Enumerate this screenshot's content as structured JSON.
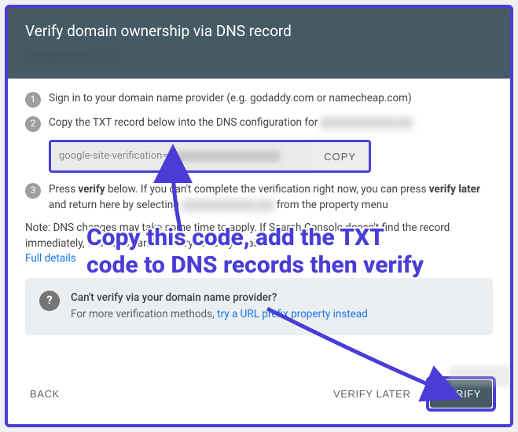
{
  "header": {
    "title": "Verify domain ownership via DNS record",
    "subtitle_placeholder": "xxxxx@xxxxxxx.xxx"
  },
  "steps": {
    "s1": "Sign in to your domain name provider (e.g. godaddy.com or namecheap.com)",
    "s2_prefix": "Copy the TXT record below into the DNS configuration for ",
    "s2_blur": "xxxxxxxxxxxxxx.xxx",
    "txt_prefix": "google-site-verification=",
    "copy_label": "COPY",
    "s3_a": "Press ",
    "s3_b": "verify",
    "s3_c": " below. If you can't complete the verification right now, you can press ",
    "s3_d": "verify later",
    "s3_e": " and return here by selecting ",
    "s3_blur": "xxxxxxxxxxxxxx.xxx",
    "s3_f": " from the property menu"
  },
  "note": {
    "a": "Note: DNS changes may take some time to apply. If Search Console doesn't find the record immediately, wait a day and then try to verify again",
    "link": "Full details"
  },
  "info": {
    "title": "Can't verify via your domain name provider?",
    "body_a": "For more verification methods, ",
    "body_link": "try a URL prefix property instead"
  },
  "footer": {
    "back": "BACK",
    "later": "VERIFY LATER",
    "verify": "VERIFY"
  },
  "annotation": {
    "text": "Copy this code, add the TXT code to DNS records then verify"
  }
}
